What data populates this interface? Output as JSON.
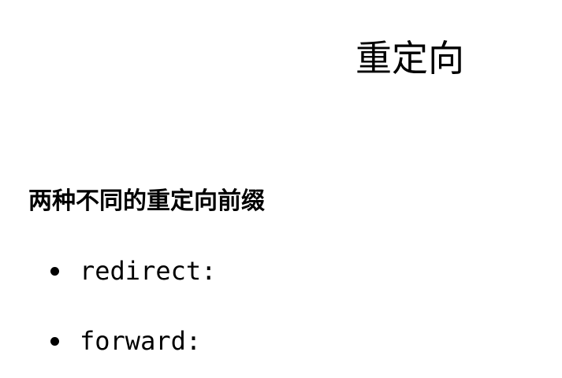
{
  "slide": {
    "title": "重定向",
    "heading": "两种不同的重定向前缀",
    "bullets": [
      "redirect:",
      "forward:"
    ]
  }
}
